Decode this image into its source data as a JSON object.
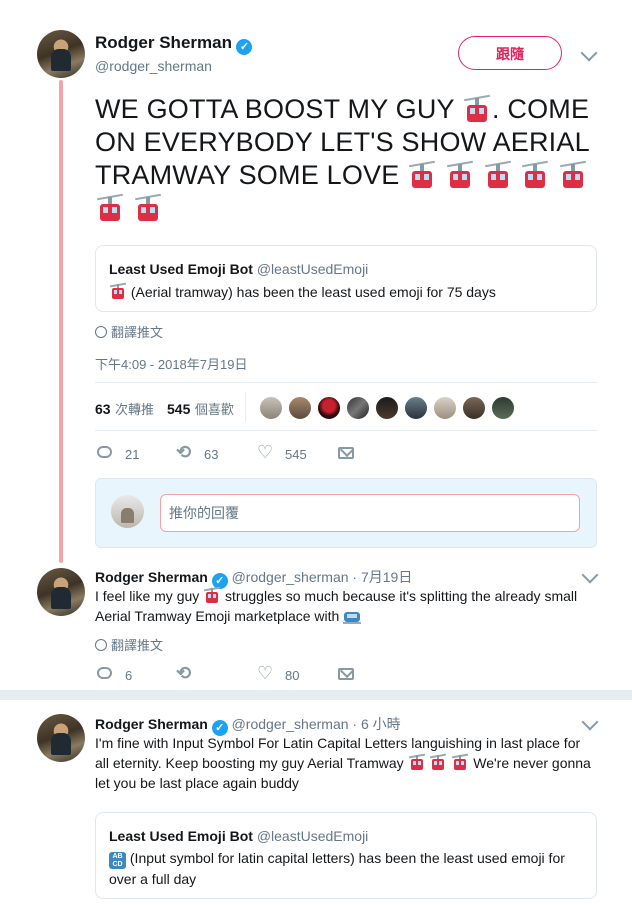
{
  "main_tweet": {
    "author_name": "Rodger Sherman",
    "author_handle": "@rodger_sherman",
    "follow_label": "跟隨",
    "text_line1": "WE GOTTA BOOST MY GUY",
    "text_line1b": ". COME",
    "text_line2": "ON EVERYBODY LET'S SHOW AERIAL",
    "text_line3": "TRAMWAY SOME LOVE",
    "quoted": {
      "name": "Least Used Emoji Bot",
      "handle": "@leastUsedEmoji",
      "text": "(Aerial tramway) has been the least used emoji for 75 days"
    },
    "translate_label": "翻譯推文",
    "timestamp": "下午4:09 - 2018年7月19日",
    "retweets_count": "63",
    "retweets_label": "次轉推",
    "likes_count": "545",
    "likes_label": "個喜歡",
    "actions": {
      "replies": "21",
      "retweets": "63",
      "likes": "545"
    },
    "reply_placeholder": "推你的回覆"
  },
  "reply_1": {
    "author_name": "Rodger Sherman",
    "author_handle": "@rodger_sherman",
    "time": "· 7月19日",
    "text_a": "I feel like my guy",
    "text_b": "struggles so much because it's splitting the already small",
    "text_c": "Aerial Tramway Emoji marketplace with",
    "translate_label": "翻譯推文",
    "actions": {
      "replies": "6",
      "retweets": "",
      "likes": "80"
    }
  },
  "reply_2": {
    "author_name": "Rodger Sherman",
    "author_handle": "@rodger_sherman",
    "time": "· 6 小時",
    "text_a": "I'm fine with Input Symbol For Latin Capital Letters languishing in last place for",
    "text_b": "all eternity. Keep boosting my guy Aerial Tramway",
    "text_c": "We're never gonna",
    "text_d": "let you be last place again buddy",
    "quoted": {
      "name": "Least Used Emoji Bot",
      "handle": "@leastUsedEmoji",
      "text_a": "(Input symbol for latin capital letters) has been the least used emoji for",
      "text_b": "over a full day"
    }
  },
  "colors": {
    "accent": "#e0245e",
    "thread_line": "#f0a6a9",
    "link": "#1da1f2"
  }
}
